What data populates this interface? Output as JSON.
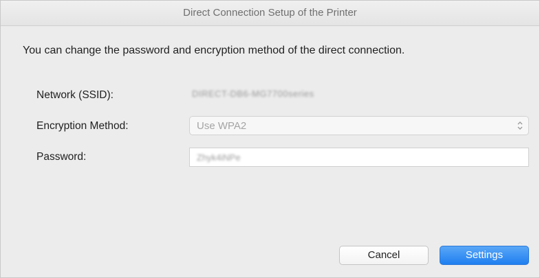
{
  "window": {
    "title": "Direct Connection Setup of the Printer"
  },
  "description": "You can change the password and encryption method of the direct connection.",
  "fields": {
    "ssid_label": "Network (SSID):",
    "ssid_value": "DIRECT-DB6-MG7700series",
    "encryption_label": "Encryption Method:",
    "encryption_value": "Use WPA2",
    "password_label": "Password:",
    "password_value": "Zhyk4iNPe"
  },
  "buttons": {
    "cancel_label": "Cancel",
    "settings_label": "Settings"
  },
  "colors": {
    "window_bg": "#ececec",
    "accent_button": "#1f7ff0"
  },
  "icons": {
    "select_arrows": "up-down-chevron-icon"
  }
}
